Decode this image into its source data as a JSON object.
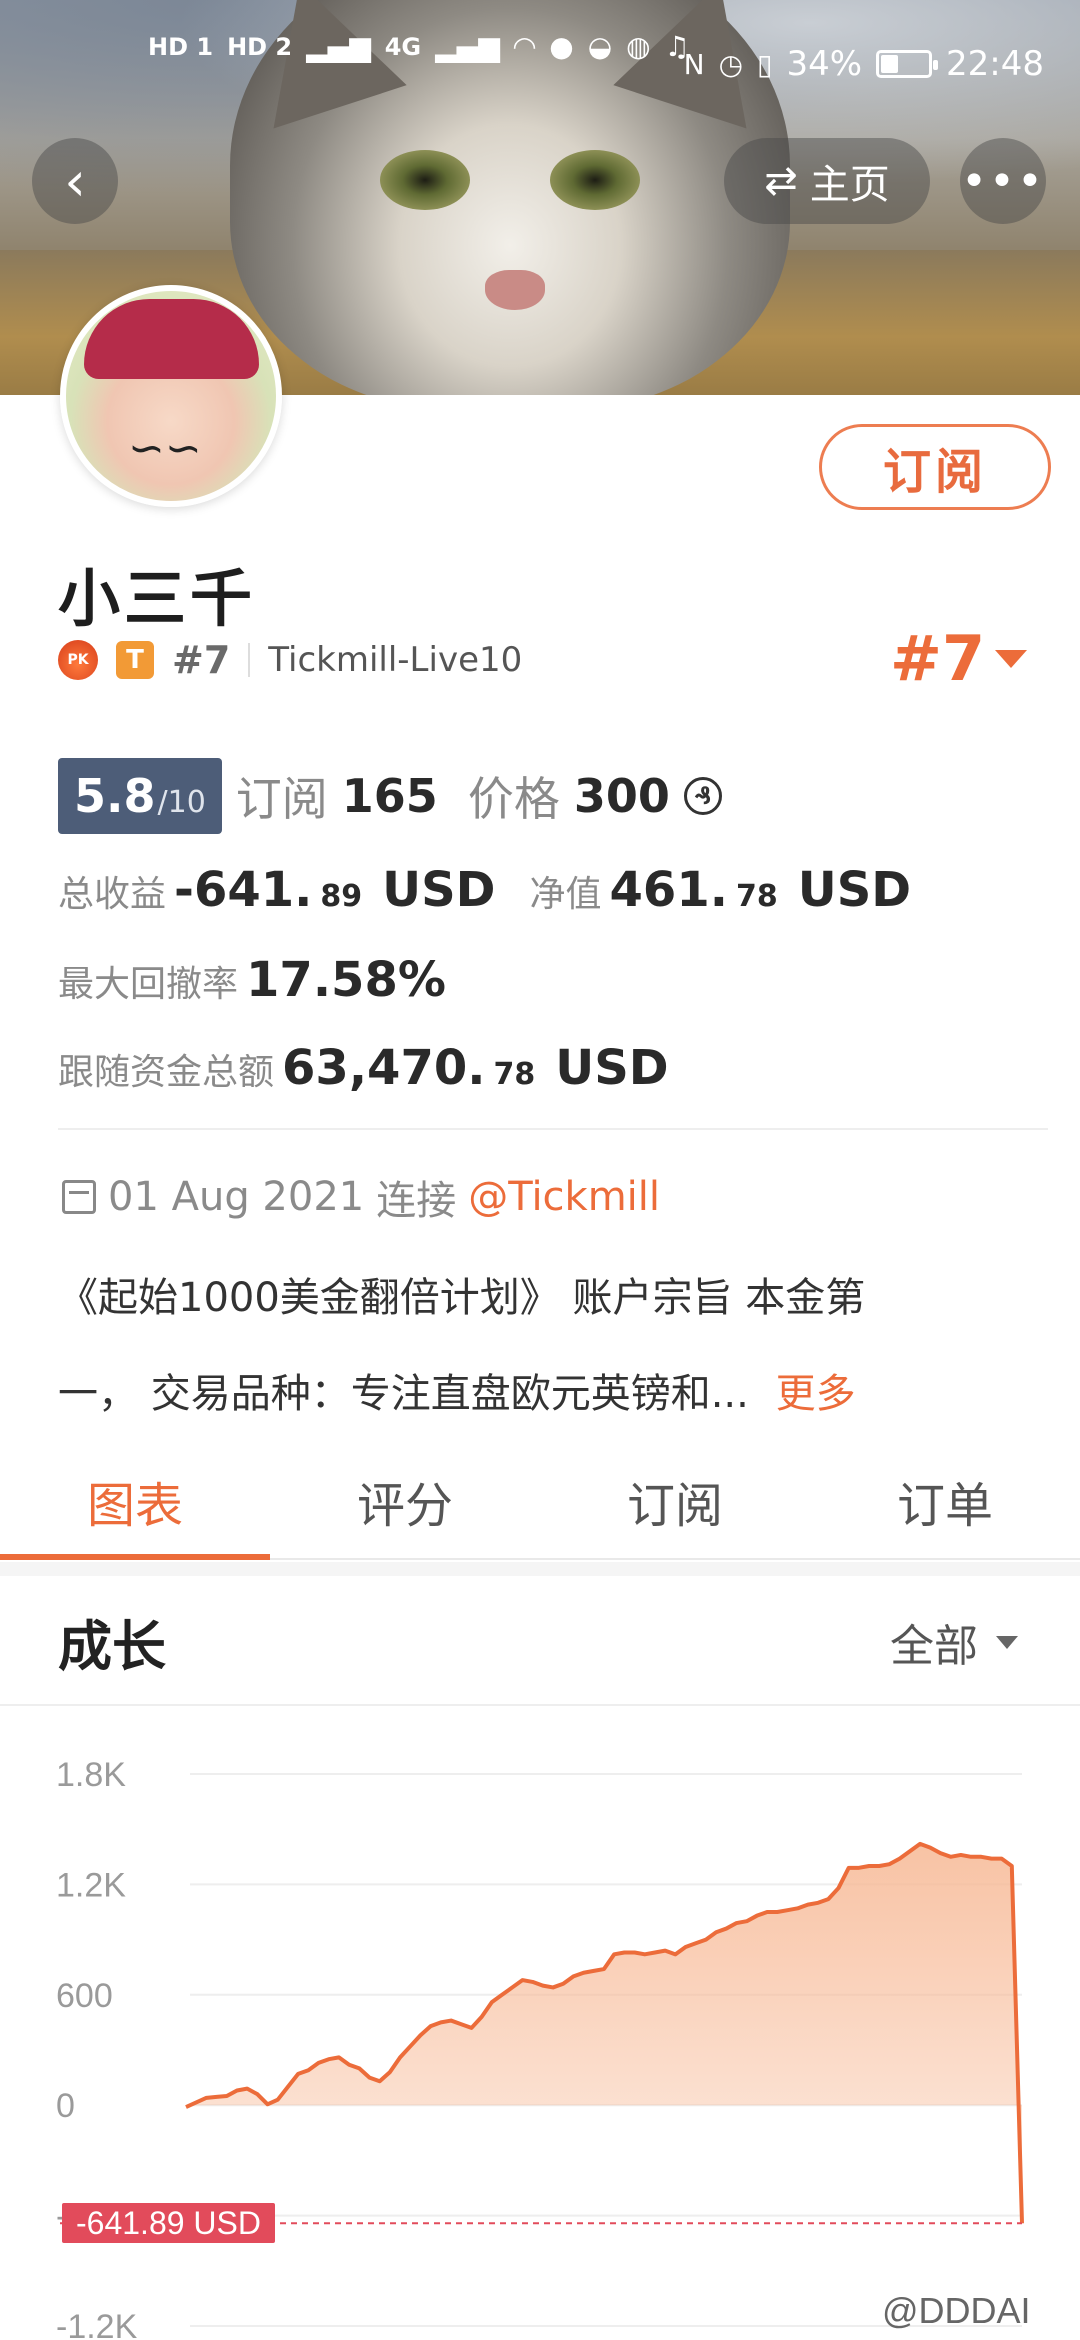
{
  "status_bar": {
    "left_labels": [
      "HD 1",
      "HD 2",
      "4G",
      "4G"
    ],
    "battery": "34%",
    "battery_level": 0.34,
    "time": "22:48",
    "icons": [
      "signal-icon",
      "wifi-icon",
      "wechat-icon",
      "qq-icon",
      "app-icon",
      "music-icon",
      "nfc-icon",
      "alarm-icon",
      "vibrate-icon",
      "battery-icon"
    ]
  },
  "header": {
    "home_label": "主页",
    "home_icon": "swap-icon",
    "back_icon": "back-icon",
    "more_icon": "more-icon"
  },
  "profile": {
    "name": "小三千",
    "rank": "#7",
    "broker": "Tickmill-Live10",
    "rank_big": "#7",
    "subscribe_label": "订阅",
    "score": "5.8",
    "score_max": "/10",
    "subscribe_count_label": "订阅",
    "subscribe_count": "165",
    "price_label": "价格",
    "price": "300",
    "price_coin": "₰",
    "total_profit_label": "总收益",
    "total_profit_main": "-641.",
    "total_profit_dec": "89",
    "total_profit_unit": "USD",
    "equity_label": "净值",
    "equity_main": "461.",
    "equity_dec": "78",
    "equity_unit": "USD",
    "max_drawdown_label": "最大回撤率",
    "max_drawdown": "17.58%",
    "follow_funds_label": "跟随资金总额",
    "follow_funds_main": "63,470.",
    "follow_funds_dec": "78",
    "follow_funds_unit": "USD",
    "since_date": "01 Aug 2021",
    "connect_label": "连接",
    "connect_link": "@Tickmill",
    "description_line1": "《起始1000美金翻倍计划》 账户宗旨 本金第",
    "description_line2": "一， 交易品种：专注直盘欧元英镑和...",
    "more_label": "更多"
  },
  "tabs": [
    {
      "label": "图表",
      "active": true
    },
    {
      "label": "评分",
      "active": false
    },
    {
      "label": "订阅",
      "active": false
    },
    {
      "label": "订单",
      "active": false
    }
  ],
  "growth": {
    "title": "成长",
    "filter_label": "全部"
  },
  "chart_data": {
    "type": "area",
    "yticks": [
      "1.8K",
      "1.2K",
      "600",
      "0",
      "-600",
      "-1.2K"
    ],
    "ylim": [
      -1200,
      1800
    ],
    "accent_color": "#ec6c3a",
    "fill_color": "#f7b894",
    "last_value_label": "-641.89 USD",
    "values": [
      -10,
      15,
      40,
      45,
      50,
      80,
      90,
      60,
      5,
      30,
      100,
      170,
      190,
      230,
      250,
      260,
      220,
      200,
      150,
      130,
      180,
      260,
      320,
      380,
      430,
      450,
      460,
      440,
      420,
      480,
      560,
      600,
      640,
      680,
      670,
      650,
      640,
      660,
      700,
      720,
      730,
      740,
      820,
      830,
      830,
      820,
      830,
      840,
      820,
      860,
      880,
      900,
      940,
      960,
      990,
      1000,
      1030,
      1050,
      1050,
      1060,
      1070,
      1090,
      1100,
      1120,
      1180,
      1290,
      1290,
      1300,
      1300,
      1310,
      1340,
      1380,
      1420,
      1400,
      1370,
      1350,
      1360,
      1350,
      1350,
      1340,
      1340,
      1300,
      -641.89
    ]
  },
  "watermark": "@DDDAI"
}
